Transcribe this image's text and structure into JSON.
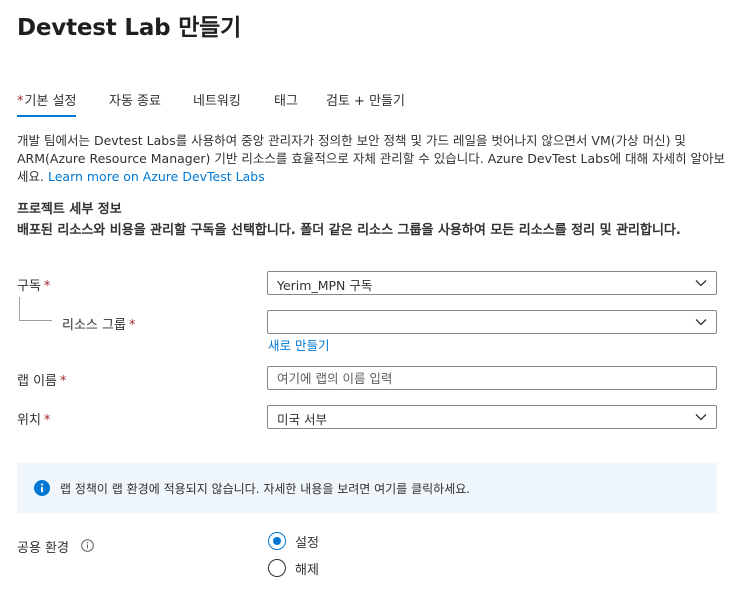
{
  "page": {
    "title": "Devtest Lab 만들기"
  },
  "tabs": [
    {
      "label": "기본 설정",
      "required": "*",
      "active": true
    },
    {
      "label": "자동 종료"
    },
    {
      "label": "네트워킹"
    },
    {
      "label": "태그"
    },
    {
      "label": "검토 + 만들기"
    }
  ],
  "description": {
    "text": "개발 팀에서는 Devtest Labs를 사용하여 중앙 관리자가 정의한 보안 정책 및 가드 레일을 벗어나지 않으면서 VM(가상 머신) 및 ARM(Azure Resource Manager) 기반 리소스를 효율적으로 자체 관리할 수 있습니다. Azure DevTest Labs에 대해 자세히 알아보세요.",
    "link": "Learn more on Azure DevTest Labs"
  },
  "project": {
    "title": "프로젝트 세부 정보",
    "description": "배포된 리소스와 비용을 관리할 구독을 선택합니다. 폴더 같은 리소스 그룹을 사용하여 모든 리소스를 정리 및 관리합니다."
  },
  "fields": {
    "subscription": {
      "label": "구독",
      "required": "*",
      "value": "Yerim_MPN 구독"
    },
    "resource_group": {
      "label": "리소스 그룹",
      "required": "*",
      "value": "",
      "create_new_link": "새로 만들기"
    },
    "lab_name": {
      "label": "랩 이름",
      "required": "*",
      "placeholder": "여기에 랩의 이름 입력"
    },
    "location": {
      "label": "위치",
      "required": "*",
      "value": "미국 서부"
    }
  },
  "info_bar": {
    "text": "랩 정책이 랩 환경에 적용되지 않습니다. 자세한 내용을 보려면 여기를 클릭하세요."
  },
  "public_environment": {
    "label": "공용 환경",
    "options": [
      {
        "label": "설정",
        "checked": true
      },
      {
        "label": "해제",
        "checked": false
      }
    ]
  },
  "colors": {
    "accent": "#0078d4",
    "required": "#a4262c",
    "info_background": "#eff6fc"
  },
  "icons": {
    "dropdown": "chevron-down-icon",
    "info": "info-icon",
    "help": "help-circle-icon"
  }
}
